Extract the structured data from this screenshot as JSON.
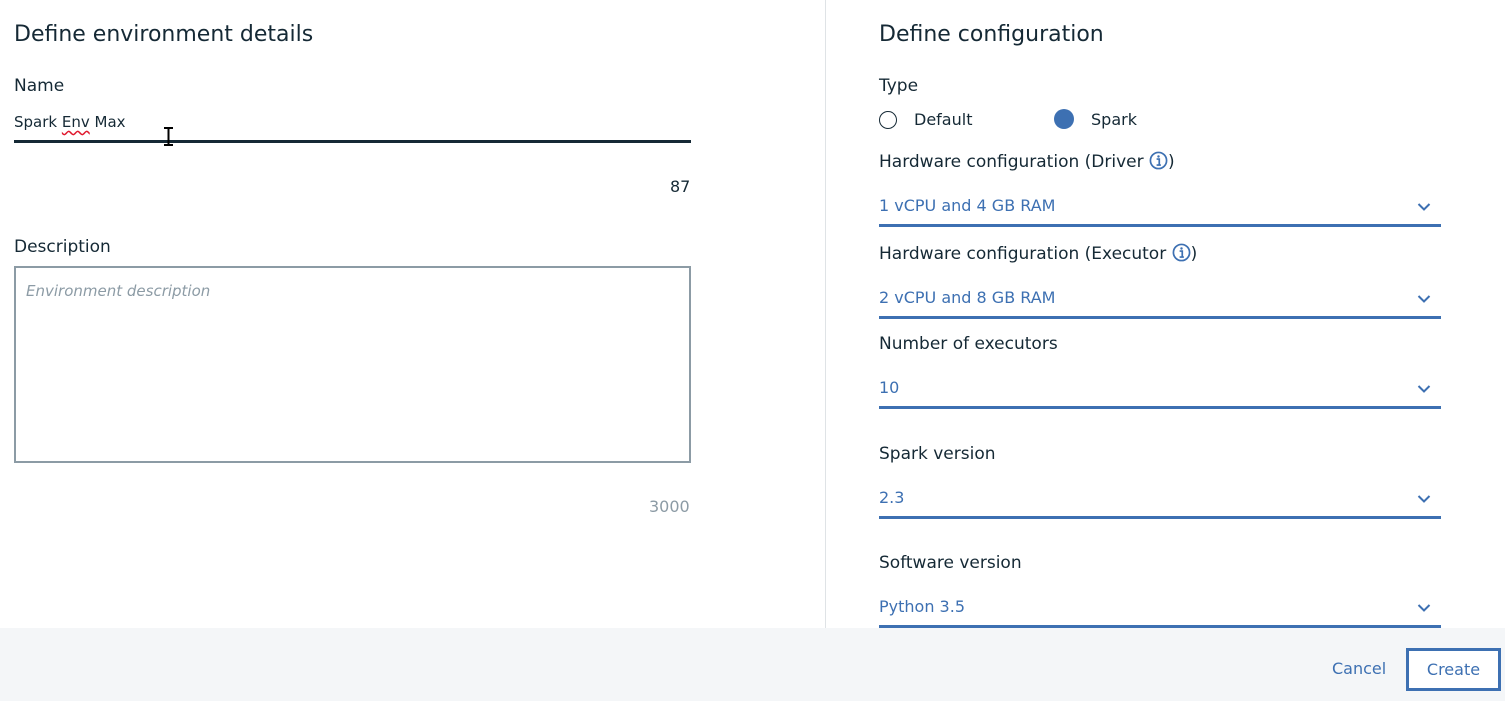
{
  "details": {
    "heading": "Define environment details",
    "name_label": "Name",
    "name_value_part1": "Spark ",
    "name_value_misspelled": "Env",
    "name_value_part2": " Max",
    "name_counter": "87",
    "description_label": "Description",
    "description_placeholder": "Environment description",
    "description_counter": "3000"
  },
  "config": {
    "heading": "Define configuration",
    "type_label": "Type",
    "type_options": [
      {
        "label": "Default",
        "selected": false
      },
      {
        "label": "Spark",
        "selected": true
      }
    ],
    "driver_label": "Hardware configuration (Driver",
    "driver_value": "1 vCPU and 4 GB RAM",
    "executor_label": "Hardware configuration (Executor",
    "executor_value": "2 vCPU and 8 GB RAM",
    "executors_label": "Number of executors",
    "executors_value": "10",
    "spark_version_label": "Spark version",
    "spark_version_value": "2.3",
    "software_version_label": "Software version",
    "software_version_value": "Python 3.5"
  },
  "footer": {
    "cancel_label": "Cancel",
    "create_label": "Create"
  },
  "colors": {
    "accent": "#3d70b2",
    "text": "#152935",
    "placeholder": "#8c9ba5",
    "footer_bg": "#f4f6f8"
  },
  "icons": [
    "info-icon",
    "chevron-down-icon",
    "text-cursor-icon"
  ]
}
